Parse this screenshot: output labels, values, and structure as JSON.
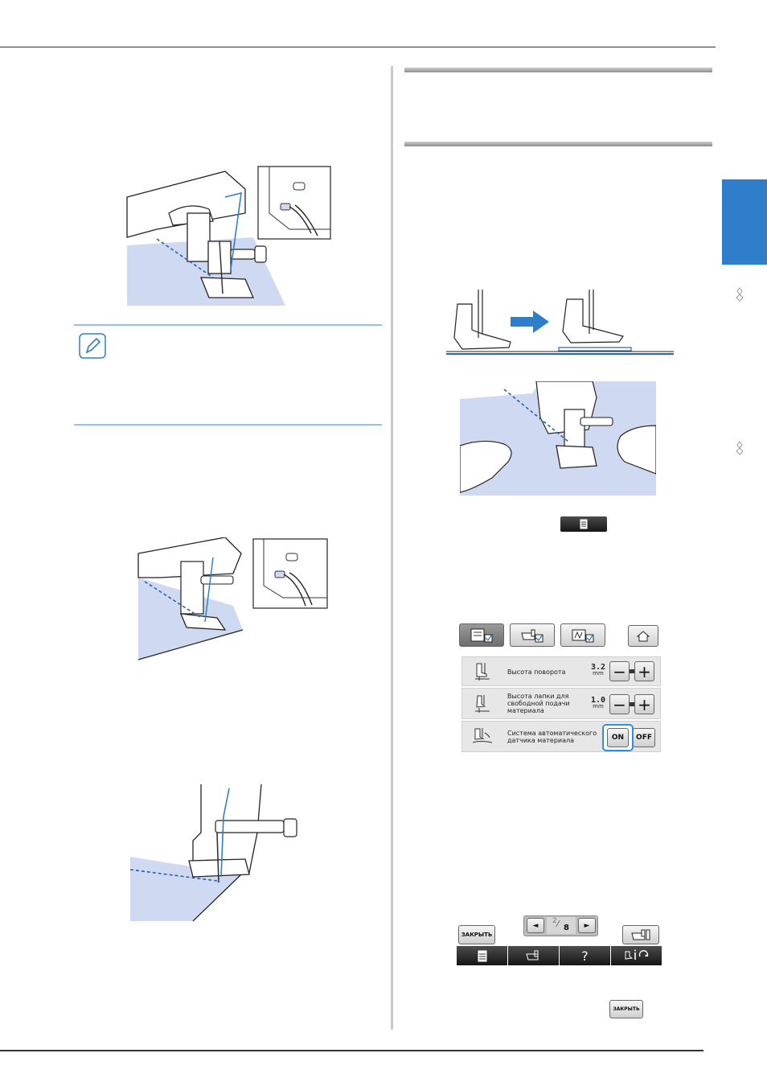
{
  "page": {
    "chapter_tab_color": "#2f7ecb",
    "side_decorations": [
      "ornament-icon",
      "ornament-icon"
    ]
  },
  "settings_panel": {
    "tabs": [
      "settings-tab-icon",
      "machine-settings-tab-icon",
      "embroidery-settings-tab-icon"
    ],
    "home_icon": "home-icon",
    "rows": [
      {
        "icon": "pivot-height-icon",
        "label": "Высота поворота",
        "value": "3.2",
        "unit": "mm"
      },
      {
        "icon": "free-motion-height-icon",
        "label": "Высота лапки для свободной подачи материала",
        "value": "1.0",
        "unit": "mm"
      },
      {
        "icon": "auto-sensor-icon",
        "label": "Система автоматического датчика материала",
        "on_label": "ON",
        "off_label": "OFF"
      }
    ],
    "minus": "−",
    "plus": "+"
  },
  "help_bar": {
    "close_label": "ЗАКРЫТЬ",
    "page_number": "2",
    "page_total": "8",
    "prev_icon": "◄",
    "next_icon": "►",
    "bottom_icons": [
      "page-icon",
      "machine-icon",
      "question-icon",
      "info-icon"
    ],
    "question_label": "?"
  },
  "close_button_label": "ЗАКРЫТЬ"
}
